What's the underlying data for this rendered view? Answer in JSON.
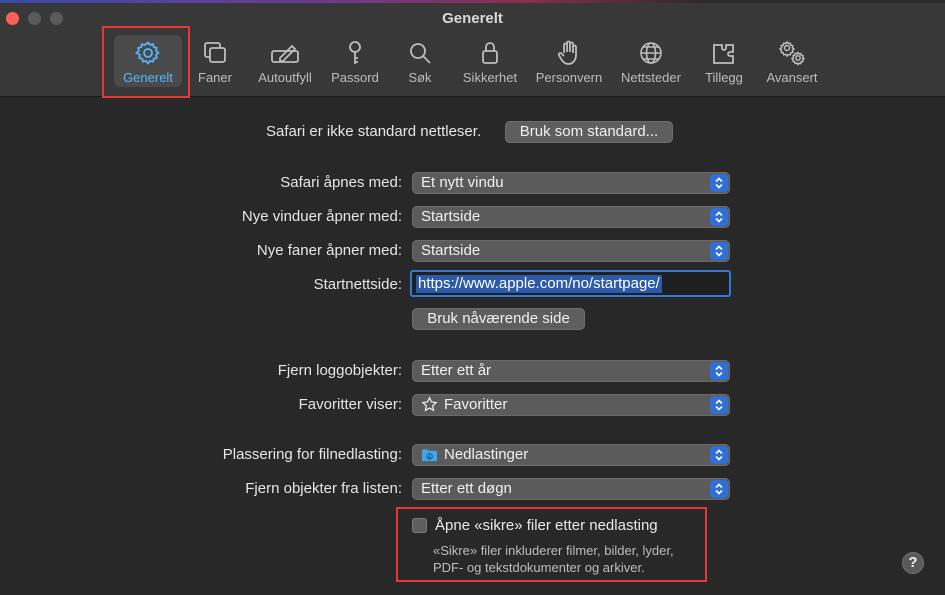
{
  "window": {
    "title": "Generelt"
  },
  "toolbar": {
    "tabs": [
      {
        "label": "Generelt",
        "icon": "gear-icon"
      },
      {
        "label": "Faner",
        "icon": "tabs-icon"
      },
      {
        "label": "Autoutfyll",
        "icon": "pencil-icon"
      },
      {
        "label": "Passord",
        "icon": "key-icon"
      },
      {
        "label": "Søk",
        "icon": "search-icon"
      },
      {
        "label": "Sikkerhet",
        "icon": "lock-icon"
      },
      {
        "label": "Personvern",
        "icon": "hand-icon"
      },
      {
        "label": "Nettsteder",
        "icon": "globe-icon"
      },
      {
        "label": "Tillegg",
        "icon": "puzzle-icon"
      },
      {
        "label": "Avansert",
        "icon": "gears-icon"
      }
    ]
  },
  "default_browser": {
    "text": "Safari er ikke standard nettleser.",
    "button": "Bruk som standard..."
  },
  "settings": {
    "opens_with": {
      "label": "Safari åpnes med:",
      "value": "Et nytt vindu"
    },
    "new_windows": {
      "label": "Nye vinduer åpner med:",
      "value": "Startside"
    },
    "new_tabs": {
      "label": "Nye faner åpner med:",
      "value": "Startside"
    },
    "homepage": {
      "label": "Startnettside:",
      "value": "https://www.apple.com/no/startpage/"
    },
    "use_current_button": "Bruk nåværende side",
    "remove_history": {
      "label": "Fjern loggobjekter:",
      "value": "Etter ett år"
    },
    "favorites": {
      "label": "Favoritter viser:",
      "value": "Favoritter"
    },
    "download_location": {
      "label": "Plassering for filnedlasting:",
      "value": "Nedlastinger"
    },
    "remove_downloads": {
      "label": "Fjern objekter fra listen:",
      "value": "Etter ett døgn"
    },
    "safe_files": {
      "label": "Åpne «sikre» filer etter nedlasting",
      "note": "«Sikre» filer inkluderer filmer, bilder, lyder, PDF- og tekstdokumenter og arkiver.",
      "checked": false
    }
  },
  "help": {
    "label": "?"
  },
  "colors": {
    "accent": "#2f6fd6",
    "active_tab": "#55b8ff",
    "highlight": "#e53935"
  }
}
